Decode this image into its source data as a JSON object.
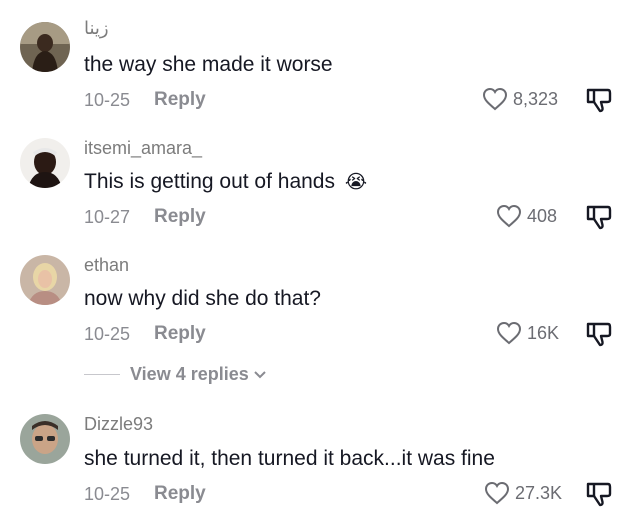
{
  "comments": [
    {
      "username": "زينا",
      "text": "the way she made it worse",
      "date": "10-25",
      "reply_label": "Reply",
      "likes": "8,323",
      "emoji": ""
    },
    {
      "username": "itsemi_amara_",
      "text": "This is getting out of hands",
      "date": "10-27",
      "reply_label": "Reply",
      "likes": "408",
      "emoji": "😭"
    },
    {
      "username": "ethan",
      "text": "now why did she do that?",
      "date": "10-25",
      "reply_label": "Reply",
      "likes": "16K",
      "emoji": ""
    },
    {
      "username": "Dizzle93",
      "text": "she turned it, then turned it back...it was fine",
      "date": "10-25",
      "reply_label": "Reply",
      "likes": "27.3K",
      "emoji": ""
    }
  ],
  "view_replies_label": "View 4 replies",
  "icons": {
    "like": "heart-outline-icon",
    "dislike": "thumbs-down-icon",
    "expand": "chevron-down-icon"
  },
  "colors": {
    "text_primary": "#161823",
    "text_secondary": "#8a8b91"
  }
}
